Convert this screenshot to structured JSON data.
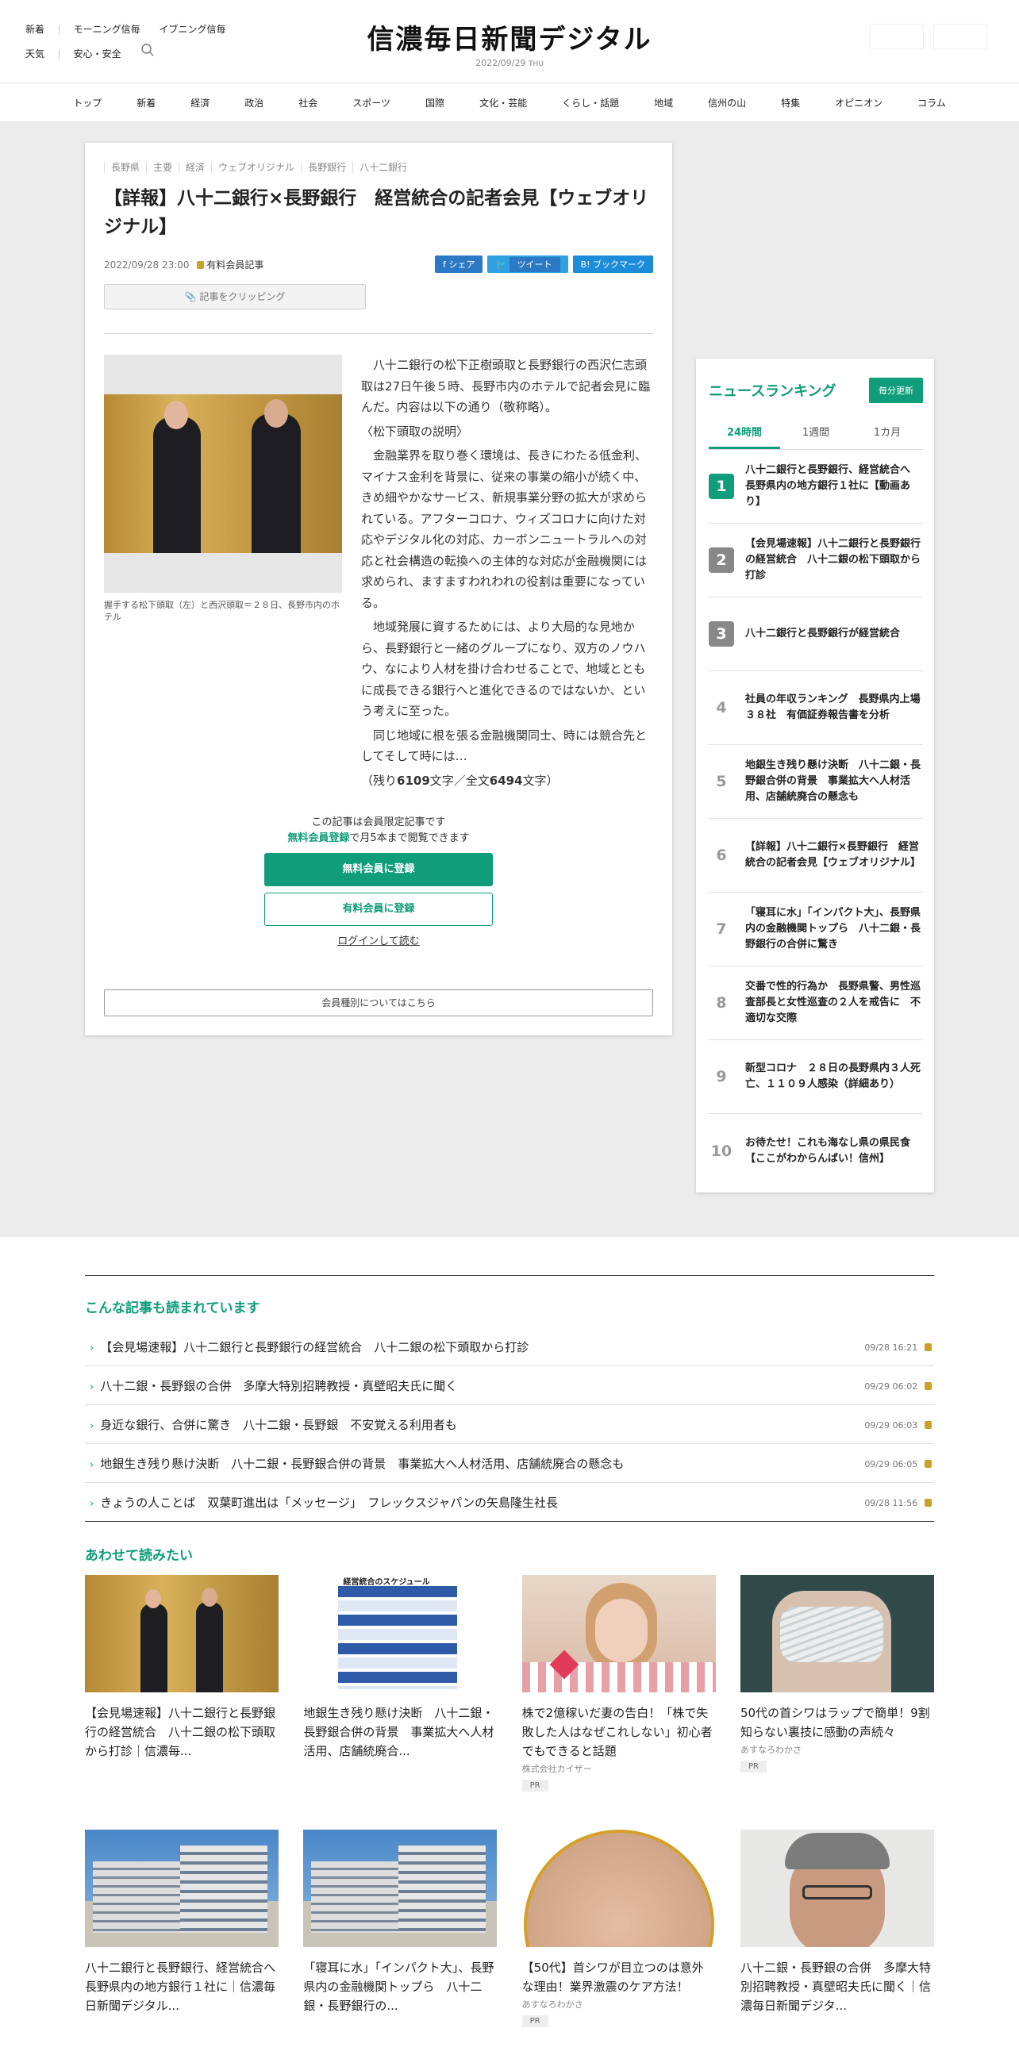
{
  "header": {
    "links_row1": [
      "新着",
      "モーニング信毎",
      "イブニング信毎"
    ],
    "links_row2": [
      "天気",
      "安心・安全"
    ],
    "logo": "信濃毎日新聞デジタル",
    "date": "2022/09/29",
    "weekday": "THU"
  },
  "nav": [
    "トップ",
    "新着",
    "経済",
    "政治",
    "社会",
    "スポーツ",
    "国際",
    "文化・芸能",
    "くらし・話題",
    "地域",
    "信州の山",
    "特集",
    "オピニオン",
    "コラム"
  ],
  "article": {
    "tags": [
      "長野県",
      "主要",
      "経済",
      "ウェブオリジナル",
      "長野銀行",
      "八十二銀行"
    ],
    "title": "【詳報】八十二銀行×長野銀行　経営統合の記者会見【ウェブオリジナル】",
    "datetime": "2022/09/28 23:00",
    "member_label": "有料会員記事",
    "share": [
      "f シェア",
      "ツイート",
      "B! ブックマーク"
    ],
    "clip_label": "記事をクリッピング",
    "caption": "握手する松下頭取（左）と西沢頭取＝２８日、長野市内のホテル",
    "paragraphs": [
      "八十二銀行の松下正樹頭取と長野銀行の西沢仁志頭取は27日午後５時、長野市内のホテルで記者会見に臨んだ。内容は以下の通り（敬称略）。",
      "金融業界を取り巻く環境は、長きにわたる低金利、マイナス金利を背景に、従来の事業の縮小が続く中、きめ細やかなサービス、新規事業分野の拡大が求められている。アフターコロナ、ウィズコロナに向けた対応やデジタル化の対応、カーボンニュートラルへの対応と社会構造の転換への主体的な対応が金融機関には求められ、ますますわれわれの役割は重要になっている。",
      "地域発展に資するためには、より大局的な見地から、長野銀行と一緒のグループになり、双方のノウハウ、なにより人材を掛け合わせることで、地域とともに成長できる銀行へと進化できるのではないか、という考えに至った。",
      "同じ地域に根を張る金融機関同士、時には競合先としてそして時には…"
    ],
    "sub_heading": "〈松下頭取の説明〉",
    "rest_prefix": "（残り",
    "rest_count": "6109",
    "rest_mid": "文字／全文",
    "total_count": "6494",
    "rest_suffix": "文字）",
    "gate_line1": "この記事は会員限定記事です",
    "gate_free": "無料会員登録",
    "gate_line2": "で月5本まで閲覧できます",
    "btn_free": "無料会員に登録",
    "btn_paid": "有料会員に登録",
    "login": "ログインして読む",
    "member_types": "会員種別についてはこちら"
  },
  "ranking": {
    "title": "ニュースランキング",
    "update": "毎分更新",
    "tabs": [
      "24時間",
      "1週間",
      "1カ月"
    ],
    "items": [
      {
        "n": "1",
        "t": "八十二銀行と長野銀行、経営統合へ　長野県内の地方銀行１社に【動画あり】"
      },
      {
        "n": "2",
        "t": "【会見場速報】八十二銀行と長野銀行の経営統合　八十二銀の松下頭取から打診"
      },
      {
        "n": "3",
        "t": "八十二銀行と長野銀行が経営統合"
      },
      {
        "n": "4",
        "t": "社員の年収ランキング　長野県内上場３８社　有価証券報告書を分析"
      },
      {
        "n": "5",
        "t": "地銀生き残り懸け決断　八十二銀・長野銀合併の背景　事業拡大へ人材活用、店舗統廃合の懸念も"
      },
      {
        "n": "6",
        "t": "【詳報】八十二銀行×長野銀行　経営統合の記者会見【ウェブオリジナル】"
      },
      {
        "n": "7",
        "t": "「寝耳に水」「インパクト大」、長野県内の金融機関トップら　八十二銀・長野銀行の合併に驚き"
      },
      {
        "n": "8",
        "t": "交番で性的行為か　長野県警、男性巡査部長と女性巡査の２人を戒告に　不適切な交際"
      },
      {
        "n": "9",
        "t": "新型コロナ　２８日の長野県内３人死亡、１１０９人感染（詳細あり）"
      },
      {
        "n": "10",
        "t": "お待たせ！これも海なし県の県民食【ここがわからんばい！信州】"
      }
    ]
  },
  "related": {
    "title": "こんな記事も読まれています",
    "items": [
      {
        "t": "【会見場速報】八十二銀行と長野銀行の経営統合　八十二銀の松下頭取から打診",
        "d": "09/28 16:21"
      },
      {
        "t": "八十二銀・長野銀の合併　多摩大特別招聘教授・真壁昭夫氏に聞く",
        "d": "09/29 06:02"
      },
      {
        "t": "身近な銀行、合併に驚き　八十二銀・長野銀　不安覚える利用者も",
        "d": "09/29 06:03"
      },
      {
        "t": "地銀生き残り懸け決断　八十二銀・長野銀合併の背景　事業拡大へ人材活用、店舗統廃合の懸念も",
        "d": "09/29 06:05"
      },
      {
        "t": "きょうの人ことば　双葉町進出は「メッセージ」　フレックスジャパンの矢島隆生社長",
        "d": "09/28 11:56"
      }
    ]
  },
  "more": {
    "title": "あわせて読みたい",
    "chart_title": "経営統合のスケジュール",
    "cards": [
      {
        "t": "【会見場速報】八十二銀行と長野銀行の経営統合　八十二銀の松下頭取から打診｜信濃毎...",
        "s": "",
        "pr": ""
      },
      {
        "t": "地銀生き残り懸け決断　八十二銀・長野銀合併の背景　事業拡大へ人材活用、店舗統廃合...",
        "s": "",
        "pr": ""
      },
      {
        "t": "株で2億稼いだ妻の告白！「株で失敗した人はなぜこれしない」初心者でもできると話題",
        "s": "株式会社カイザー",
        "pr": "PR"
      },
      {
        "t": "50代の首シワはラップで簡単！9割知らない裏技に感動の声続々",
        "s": "あすなろわかさ",
        "pr": "PR"
      },
      {
        "t": "八十二銀行と長野銀行、経営統合へ　長野県内の地方銀行１社に｜信濃毎日新聞デジタル...",
        "s": "",
        "pr": ""
      },
      {
        "t": "「寝耳に水」「インパクト大」、長野県内の金融機関トップら　八十二銀・長野銀行の...",
        "s": "",
        "pr": ""
      },
      {
        "t": "【50代】首シワが目立つのは意外な理由！業界激震のケア方法！",
        "s": "あすなろわかさ",
        "pr": "PR"
      },
      {
        "t": "八十二銀・長野銀の合併　多摩大特別招聘教授・真壁昭夫氏に聞く｜信濃毎日新聞デジタ...",
        "s": "",
        "pr": ""
      }
    ]
  }
}
